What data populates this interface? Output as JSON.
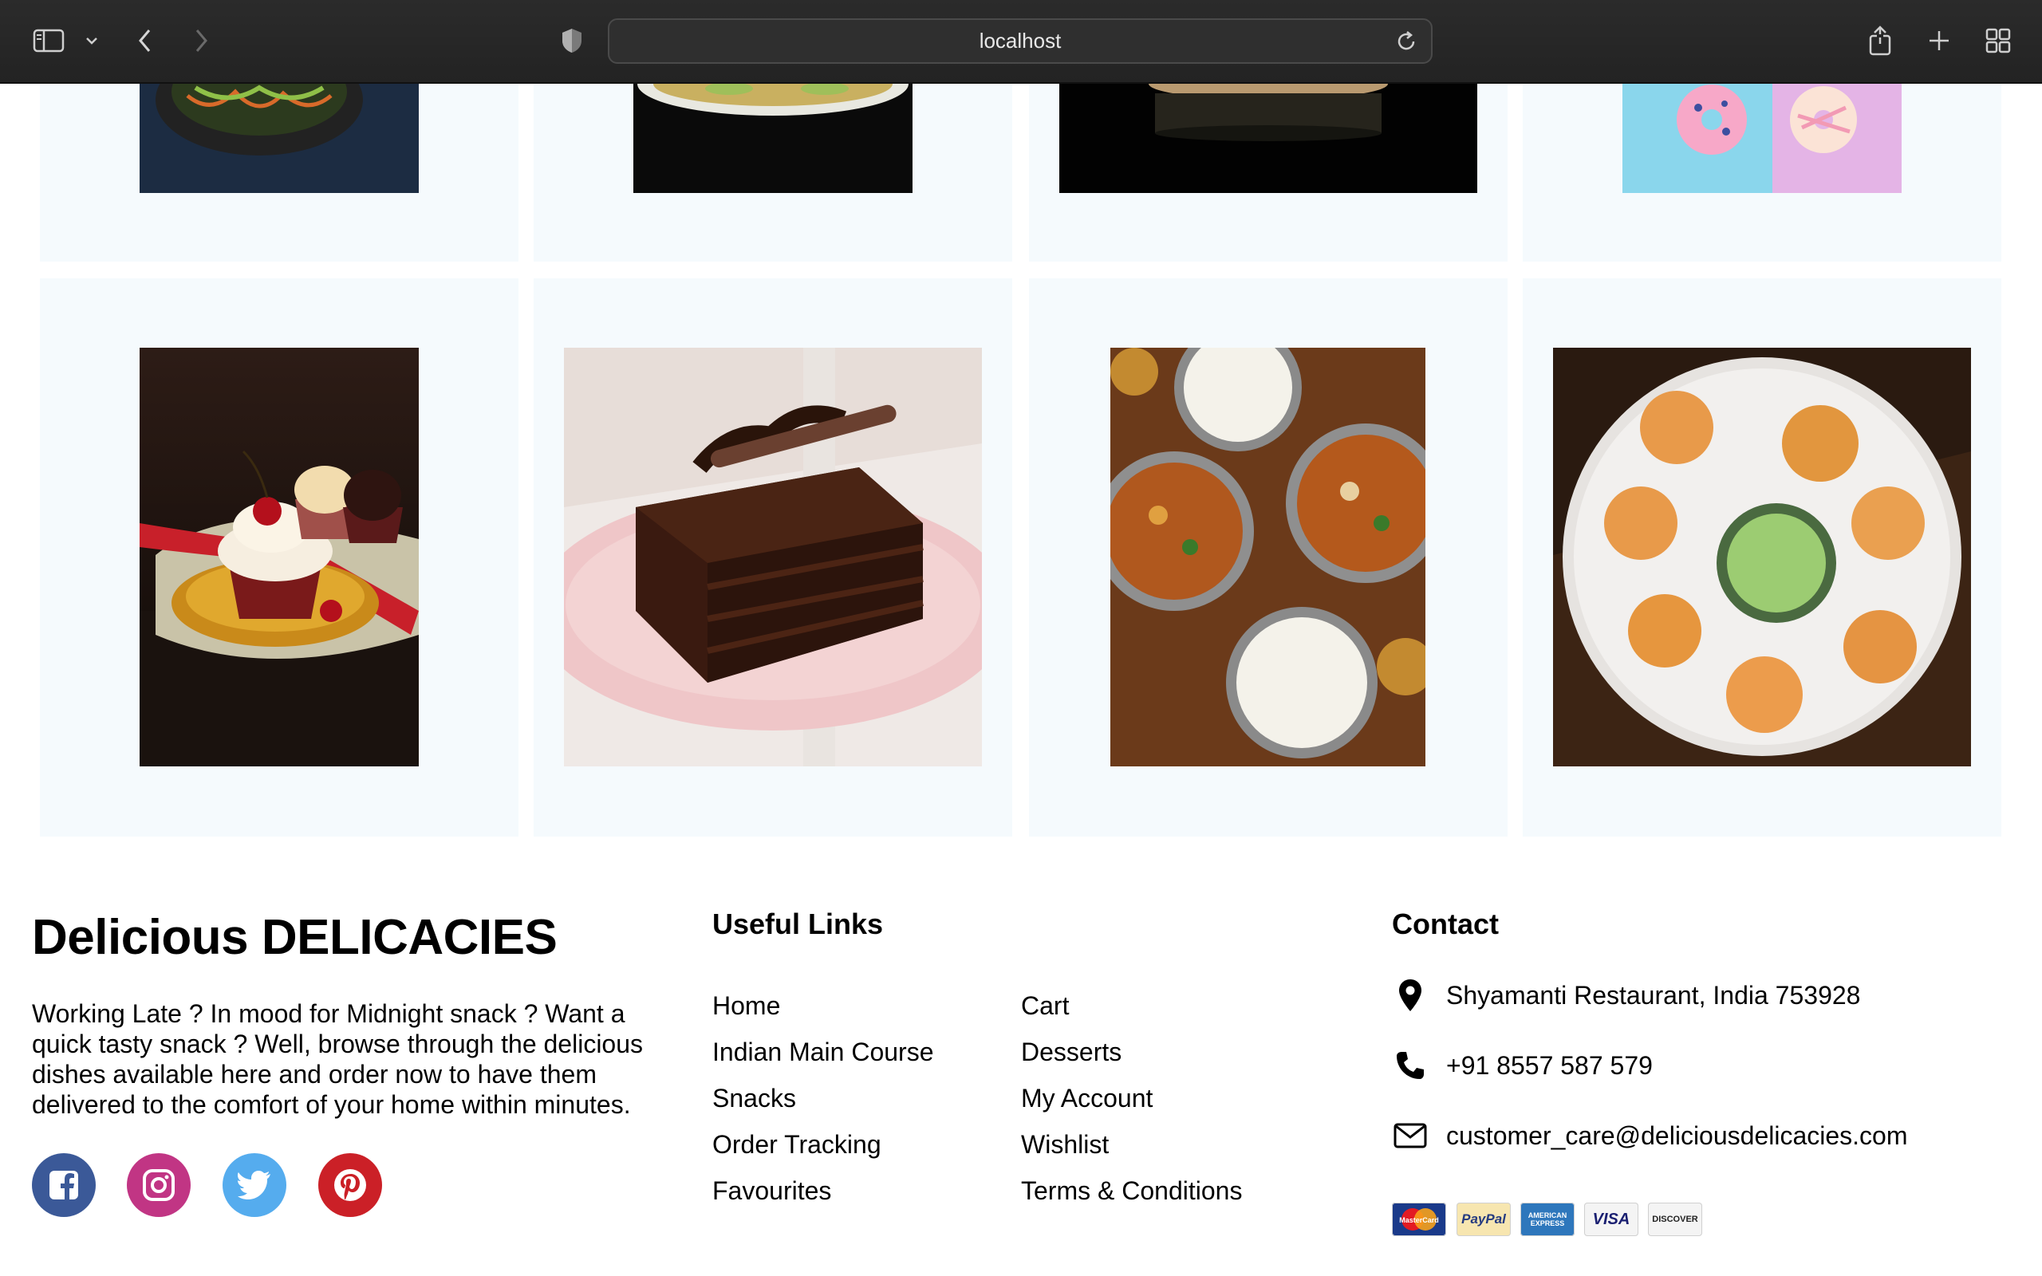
{
  "browser": {
    "url": "localhost",
    "icons": {
      "sidebar": "sidebar-icon",
      "dropdown": "chevron-down-icon",
      "back": "chevron-left-icon",
      "forward": "chevron-right-icon",
      "privacy": "shield-icon",
      "reload": "reload-icon",
      "share": "share-icon",
      "new_tab": "plus-icon",
      "tab_overview": "grid-icon"
    }
  },
  "products": {
    "top_row": [
      {
        "name": "salad-dish-image",
        "colors": [
          "#1e3048",
          "#0f1a28"
        ]
      },
      {
        "name": "pasta-dish-image",
        "colors": [
          "#111111",
          "#050505"
        ]
      },
      {
        "name": "dark-dish-image",
        "colors": [
          "#0a0a0a",
          "#1a1a14"
        ]
      },
      {
        "name": "donuts-image",
        "colors": [
          "#8fd8ec",
          "#e3b5e4"
        ]
      }
    ],
    "bottom_row": [
      {
        "name": "cupcakes-image",
        "colors": [
          "#2a1a14",
          "#0f0907"
        ]
      },
      {
        "name": "chocolate-cake-image",
        "colors": [
          "#f2e6e8",
          "#c89aa0"
        ]
      },
      {
        "name": "indian-curry-image",
        "colors": [
          "#7a4a24",
          "#a85a2a"
        ]
      },
      {
        "name": "snacks-platter-image",
        "colors": [
          "#3a2414",
          "#1a0e06"
        ]
      }
    ]
  },
  "footer": {
    "brand": "Delicious DELICACIES",
    "about": "Working Late ? In mood for Midnight snack ? Want a quick tasty snack ? Well, browse through the delicious dishes available here and order now to have them delivered to the comfort of your home within minutes.",
    "social": [
      {
        "name": "facebook-icon",
        "color": "#3b5998"
      },
      {
        "name": "instagram-icon",
        "color": "#c13584"
      },
      {
        "name": "twitter-icon",
        "color": "#55acee"
      },
      {
        "name": "pinterest-icon",
        "color": "#cb2027"
      }
    ],
    "useful_links_title": "Useful Links",
    "links_col1": [
      "Home",
      "Indian Main Course",
      "Snacks",
      "Order Tracking",
      "Favourites"
    ],
    "links_col2": [
      "Cart",
      "Desserts",
      "My Account",
      "Wishlist",
      "Terms & Conditions"
    ],
    "contact_title": "Contact",
    "contact": {
      "address": "Shyamanti Restaurant, India 753928",
      "phone": "+91 8557 587 579",
      "email": "customer_care@deliciousdelicacies.com"
    },
    "payments": [
      "MasterCard",
      "PayPal",
      "AMERICAN EXPRESS",
      "VISA",
      "DISCOVER"
    ]
  }
}
